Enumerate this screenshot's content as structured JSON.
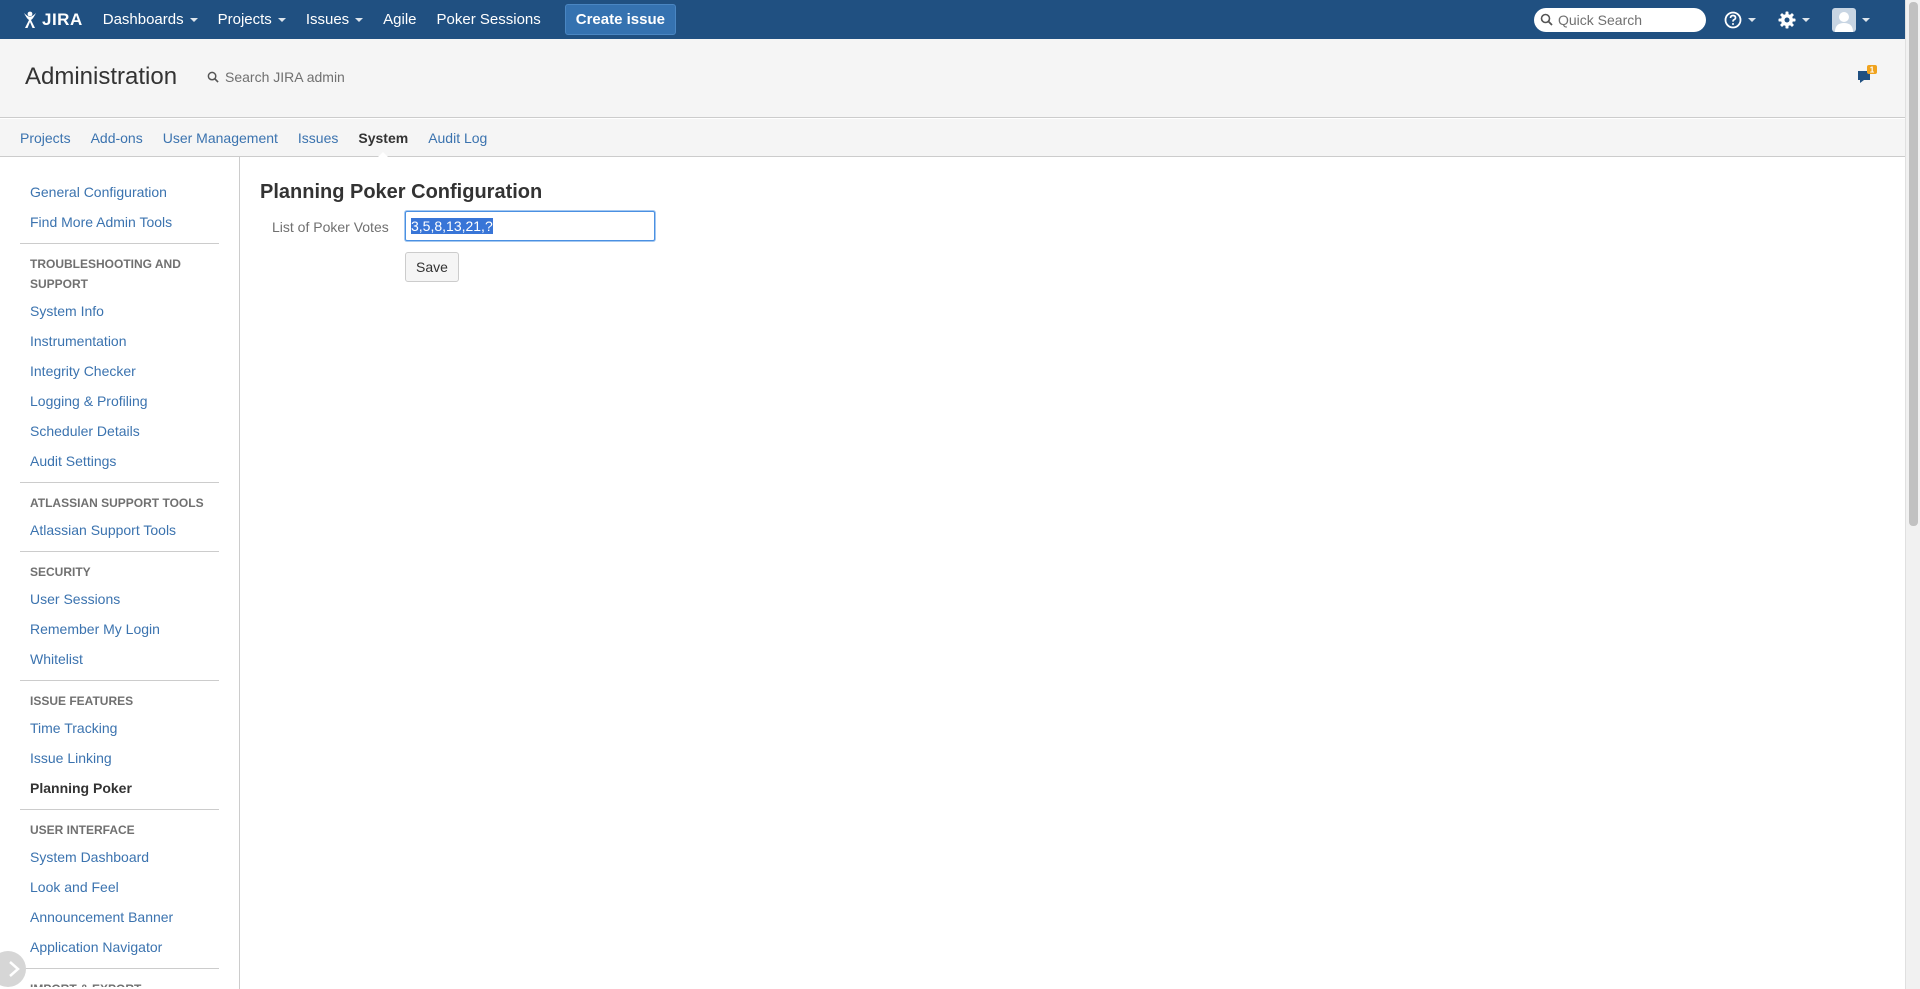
{
  "header": {
    "logo_text": "JIRA",
    "nav": [
      {
        "label": "Dashboards",
        "dropdown": true
      },
      {
        "label": "Projects",
        "dropdown": true
      },
      {
        "label": "Issues",
        "dropdown": true
      },
      {
        "label": "Agile",
        "dropdown": false
      },
      {
        "label": "Poker Sessions",
        "dropdown": false
      }
    ],
    "create_label": "Create issue",
    "quick_search_placeholder": "Quick Search",
    "icons": [
      "help-icon",
      "gear-icon",
      "user-avatar-icon"
    ],
    "bg_color": "#205081",
    "create_color": "#3572b0"
  },
  "admin": {
    "title": "Administration",
    "search_placeholder": "Search JIRA admin",
    "notification_count": "1"
  },
  "tabs": [
    {
      "label": "Projects",
      "active": false
    },
    {
      "label": "Add-ons",
      "active": false
    },
    {
      "label": "User Management",
      "active": false
    },
    {
      "label": "Issues",
      "active": false
    },
    {
      "label": "System",
      "active": true
    },
    {
      "label": "Audit Log",
      "active": false
    }
  ],
  "sidebar": {
    "top_links": [
      "General Configuration",
      "Find More Admin Tools"
    ],
    "sections": [
      {
        "heading": "TROUBLESHOOTING AND SUPPORT",
        "links": [
          "System Info",
          "Instrumentation",
          "Integrity Checker",
          "Logging & Profiling",
          "Scheduler Details",
          "Audit Settings"
        ]
      },
      {
        "heading": "ATLASSIAN SUPPORT TOOLS",
        "links": [
          "Atlassian Support Tools"
        ]
      },
      {
        "heading": "SECURITY",
        "links": [
          "User Sessions",
          "Remember My Login",
          "Whitelist"
        ]
      },
      {
        "heading": "ISSUE FEATURES",
        "links": [
          "Time Tracking",
          "Issue Linking",
          "Planning Poker"
        ],
        "active": "Planning Poker"
      },
      {
        "heading": "USER INTERFACE",
        "links": [
          "System Dashboard",
          "Look and Feel",
          "Announcement Banner",
          "Application Navigator"
        ]
      },
      {
        "heading": "IMPORT & EXPORT",
        "links": []
      }
    ]
  },
  "main": {
    "title": "Planning Poker Configuration",
    "field_label": "List of Poker Votes",
    "field_value": "3,5,8,13,21,?",
    "save_label": "Save"
  }
}
